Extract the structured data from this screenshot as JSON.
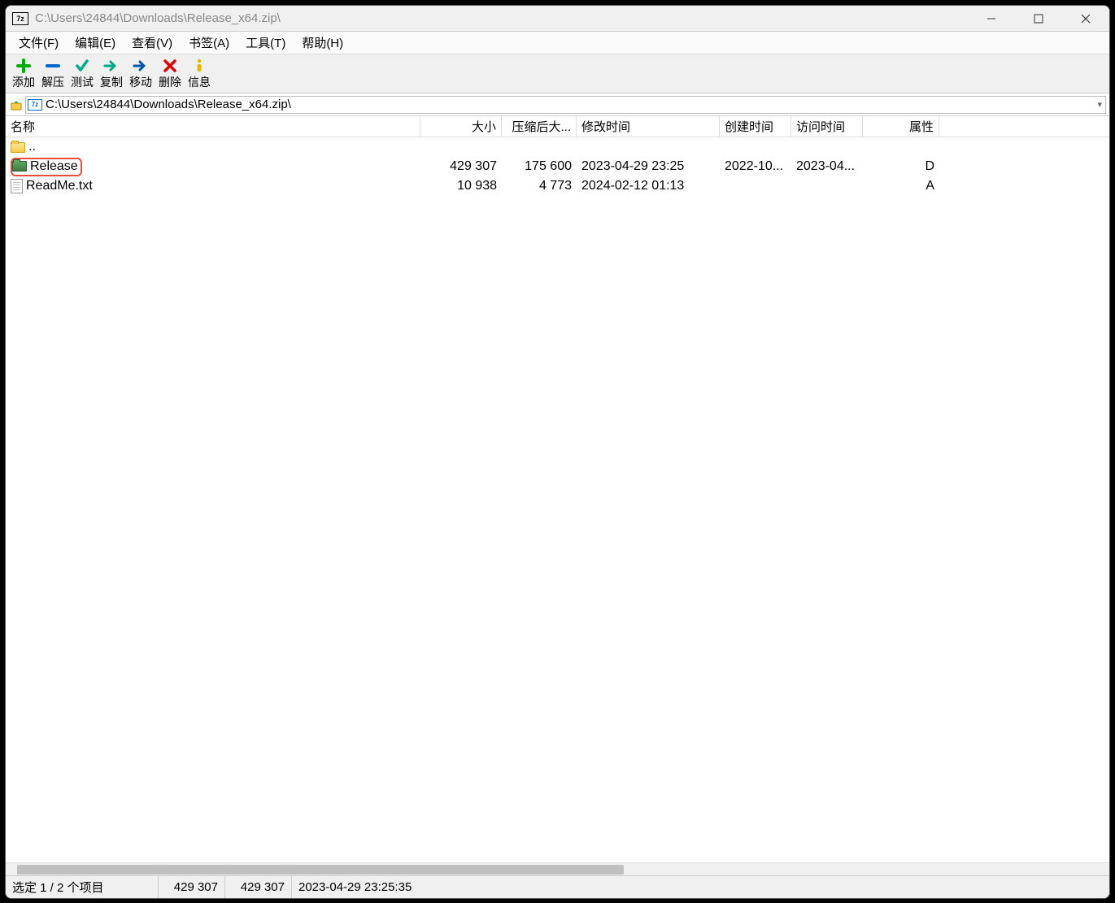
{
  "title": "C:\\Users\\24844\\Downloads\\Release_x64.zip\\",
  "menus": [
    "文件(F)",
    "编辑(E)",
    "查看(V)",
    "书签(A)",
    "工具(T)",
    "帮助(H)"
  ],
  "toolbar": [
    {
      "id": "add",
      "label": "添加"
    },
    {
      "id": "extract",
      "label": "解压"
    },
    {
      "id": "test",
      "label": "测试"
    },
    {
      "id": "copy",
      "label": "复制"
    },
    {
      "id": "move",
      "label": "移动"
    },
    {
      "id": "delete",
      "label": "删除"
    },
    {
      "id": "info",
      "label": "信息"
    }
  ],
  "address": "C:\\Users\\24844\\Downloads\\Release_x64.zip\\",
  "columns": {
    "name": "名称",
    "size": "大小",
    "packed": "压缩后大...",
    "modified": "修改时间",
    "created": "创建时间",
    "accessed": "访问时间",
    "attr": "属性"
  },
  "rows": [
    {
      "type": "updir",
      "name": ".."
    },
    {
      "type": "folder",
      "name": "Release",
      "size": "429 307",
      "packed": "175 600",
      "modified": "2023-04-29 23:25",
      "created": "2022-10...",
      "accessed": "2023-04...",
      "attr": "D",
      "selected": true
    },
    {
      "type": "file",
      "name": "ReadMe.txt",
      "size": "10 938",
      "packed": "4 773",
      "modified": "2024-02-12 01:13",
      "created": "",
      "accessed": "",
      "attr": "A"
    }
  ],
  "status": {
    "sel": "选定 1 / 2 个项目",
    "s1": "429 307",
    "s2": "429 307",
    "date": "2023-04-29 23:25:35"
  }
}
